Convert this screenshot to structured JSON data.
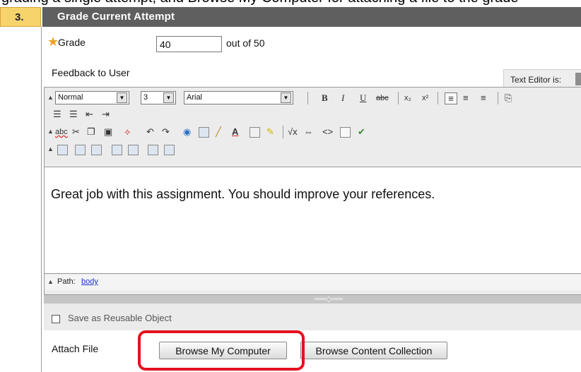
{
  "caption_fragment": "grading a single attempt, and Browse My Computer for attaching a file to the grade",
  "step": {
    "number": "3.",
    "title": "Grade Current Attempt"
  },
  "grade": {
    "label": "Grade",
    "value": "40",
    "out_of": "out of 50"
  },
  "feedback": {
    "label": "Feedback to User",
    "text_editor_status": "Text Editor is:"
  },
  "toolbar": {
    "format_value": "Normal",
    "size_value": "3",
    "font_value": "Arial",
    "row1_buttons": [
      "B",
      "I",
      "U",
      "abc"
    ],
    "row3_symbol": "abc"
  },
  "editor": {
    "content": "Great job with this assignment.  You should improve your references.",
    "path_label": "Path:",
    "path_link": "body"
  },
  "reusable": {
    "label": "Save as Reusable Object"
  },
  "attach": {
    "label": "Attach File",
    "browse_computer": "Browse My Computer",
    "browse_collection": "Browse Content Collection"
  },
  "colors": {
    "header_bg": "#5f5f5f",
    "step_num_bg": "#f7d36b",
    "highlight": "#e4111f",
    "link": "#1a37c8",
    "required_star": "#f0a020"
  }
}
